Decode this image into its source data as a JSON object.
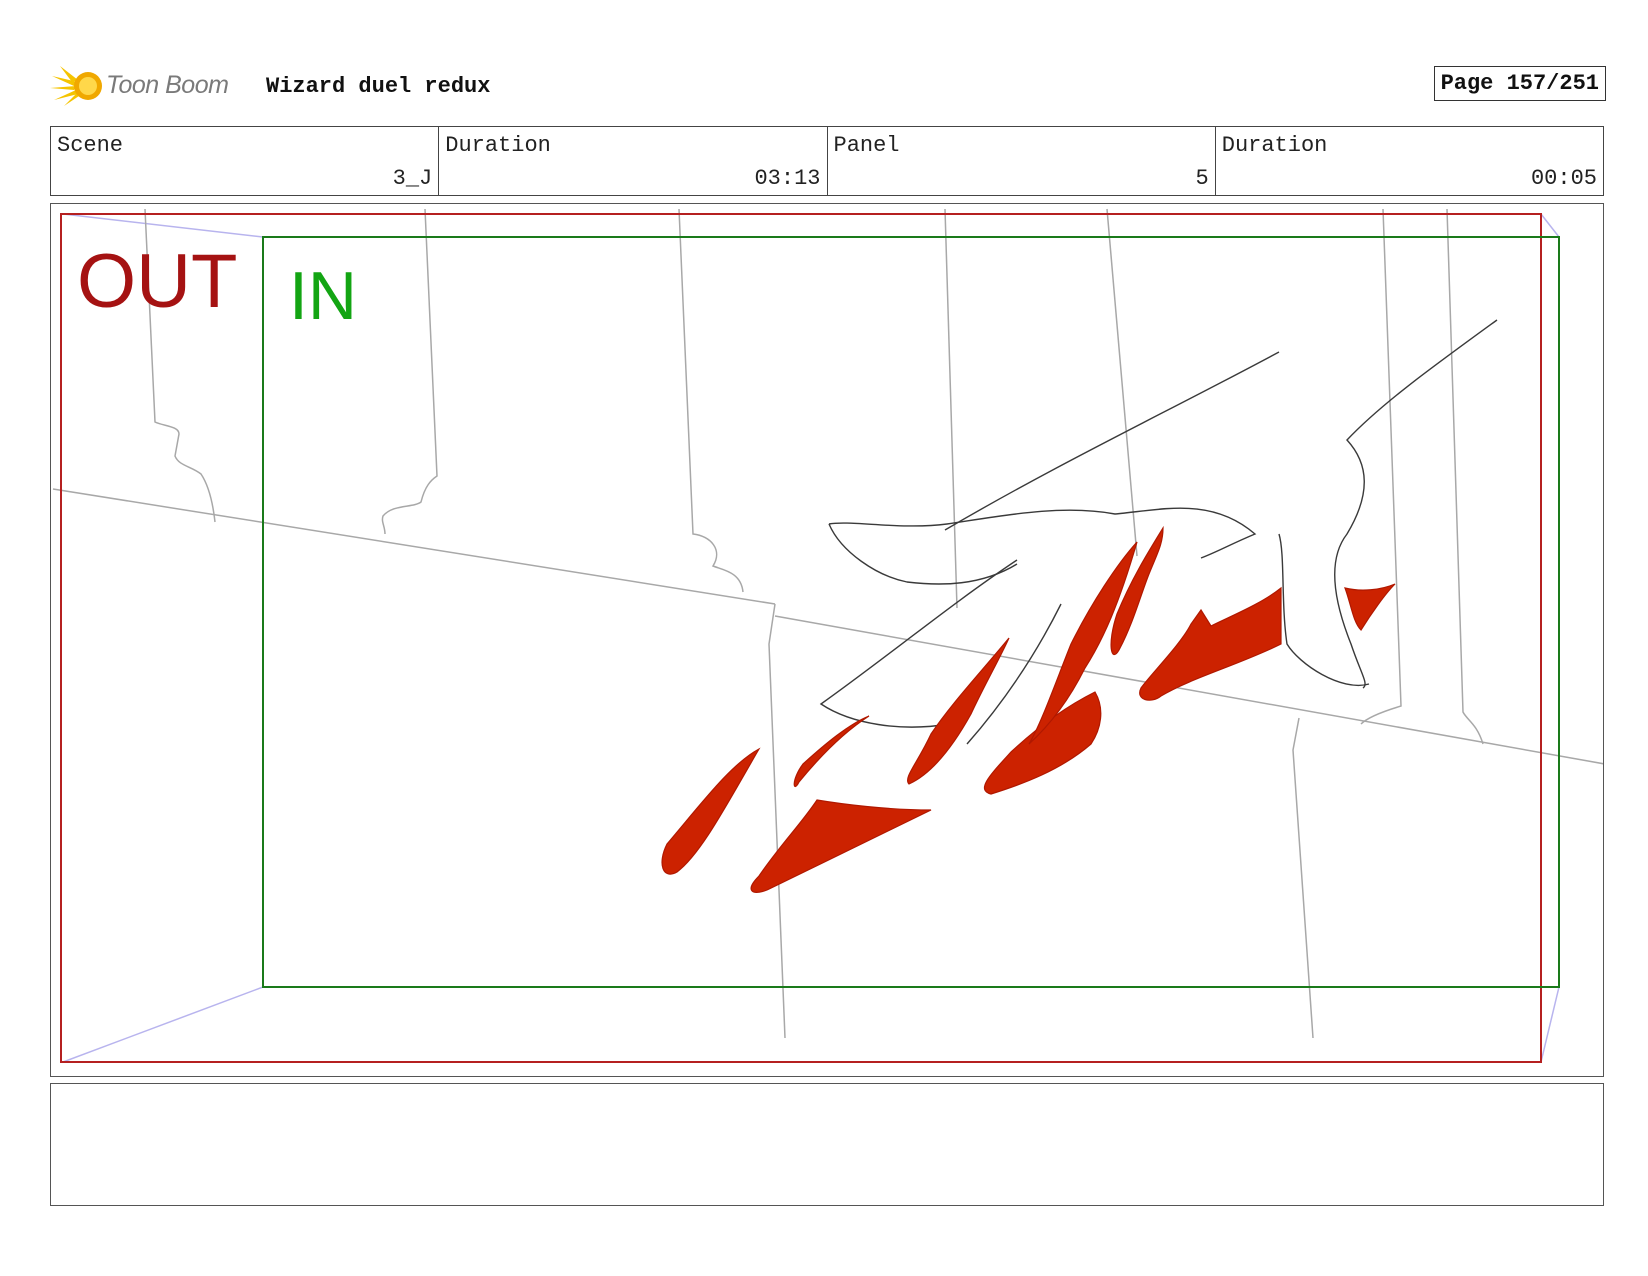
{
  "app": {
    "logo_text": "Toon Boom",
    "project_title": "Wizard duel redux",
    "page_label": "Page 157/251"
  },
  "info": {
    "scene_label": "Scene",
    "scene_value": "3_J",
    "duration_label": "Duration",
    "duration_value": "03:13",
    "panel_label": "Panel",
    "panel_value": "5",
    "panel_duration_label": "Duration",
    "panel_duration_value": "00:05"
  },
  "camera": {
    "out_label": "OUT",
    "in_label": "IN",
    "out_color": "#a51212",
    "in_color": "#13a513"
  },
  "colors": {
    "blood": "#cc2200",
    "sketch": "#333333",
    "guides": "#a8a8a8",
    "perspective": "#b8b4ee"
  },
  "notes": {
    "text": ""
  }
}
